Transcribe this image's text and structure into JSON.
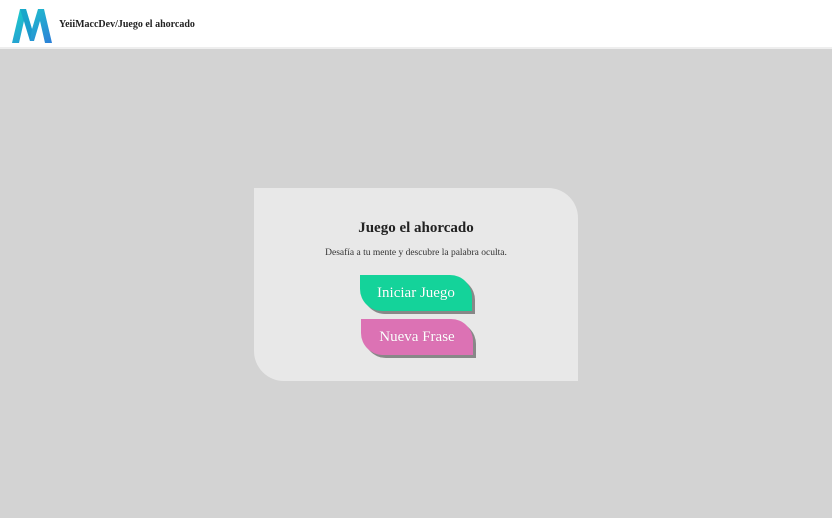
{
  "header": {
    "brand_text": "YeiiMaccDev/Juego el ahorcado",
    "logo_icon": "m-logo-icon",
    "logo_colors": [
      "#1ad1c9",
      "#2c7fd8"
    ]
  },
  "card": {
    "title": "Juego el ahorcado",
    "subtitle": "Desafía a tu mente y descubre la palabra oculta.",
    "start_button_label": "Iniciar Juego",
    "new_phrase_button_label": "Nueva Frase"
  },
  "colors": {
    "page_background": "#d3d3d3",
    "card_background": "#e8e8e8",
    "start_button": "#14d39a",
    "new_phrase_button": "#dc72b4"
  }
}
